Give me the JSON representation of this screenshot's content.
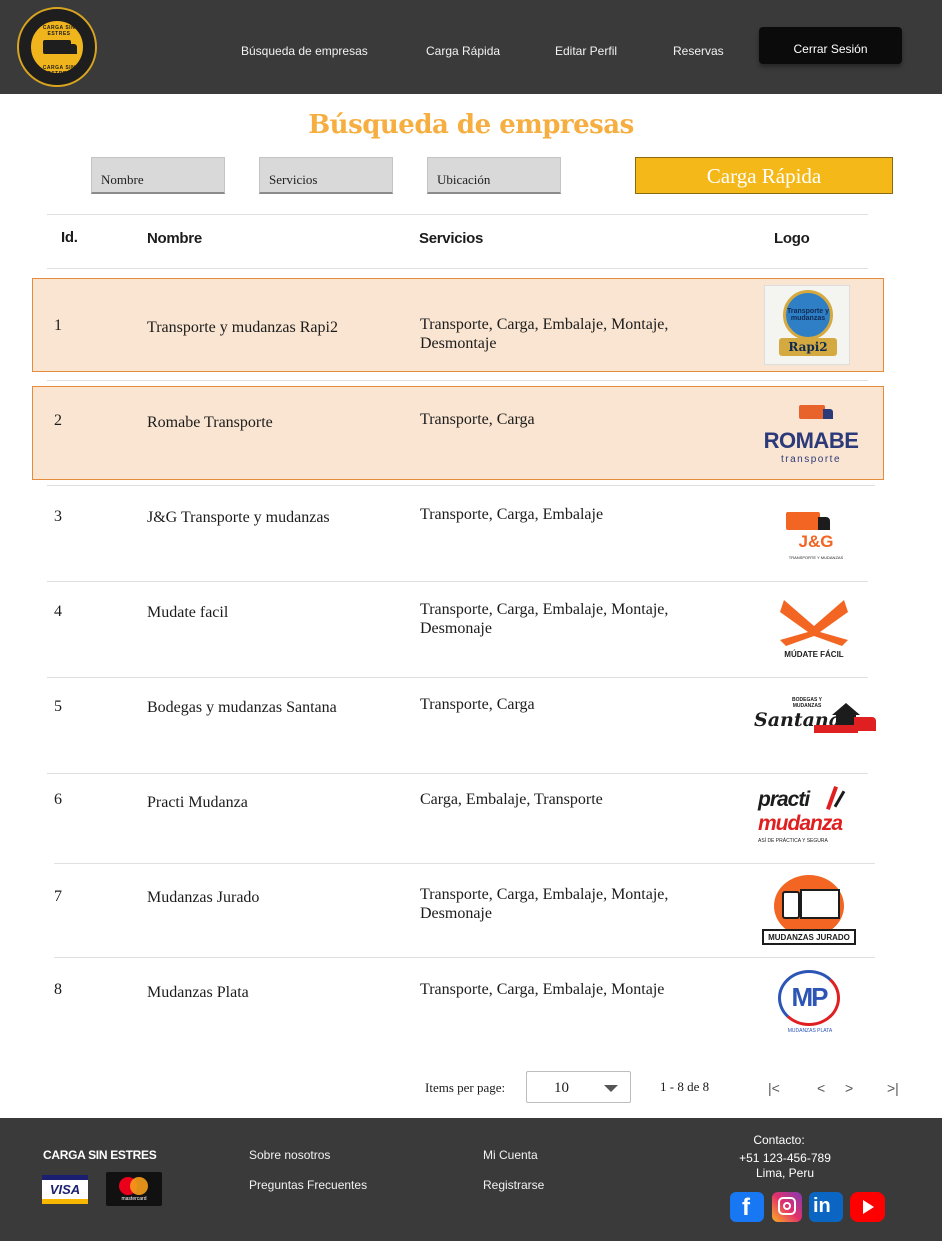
{
  "header": {
    "logo_text_top": "CARGA SIN ESTRES",
    "logo_text_bottom": "CARGA SIN ESTRES",
    "nav": {
      "busqueda": "Búsqueda de empresas",
      "carga_rapida": "Carga Rápida",
      "editar_perfil": "Editar Perfil",
      "reservas": "Reservas"
    },
    "logout_label": "Cerrar Sesión"
  },
  "main": {
    "title": "Búsqueda de empresas",
    "filters": {
      "nombre": "Nombre",
      "servicios": "Servicios",
      "ubicacion": "Ubicación"
    },
    "quick_button": "Carga Rápida",
    "table": {
      "columns": {
        "id": "Id.",
        "nombre": "Nombre",
        "servicios": "Servicios",
        "logo": "Logo"
      },
      "rows": [
        {
          "id": "1",
          "nombre": "Transporte y mudanzas Rapi2",
          "servicios": "Transporte, Carga, Embalaje, Montaje, Desmontaje",
          "logo_text": "Rapi2",
          "logo_sub": "Transporte y mudanzas"
        },
        {
          "id": "2",
          "nombre": "Romabe Transporte",
          "servicios": "Transporte, Carga",
          "logo_text": "ROMABE",
          "logo_sub": "transporte"
        },
        {
          "id": "3",
          "nombre": "J&G Transporte y mudanzas",
          "servicios": "Transporte, Carga, Embalaje",
          "logo_text": "J&G",
          "logo_sub": "TRANSPORTE Y MUDANZAS"
        },
        {
          "id": "4",
          "nombre": "Mudate facil",
          "servicios": "Transporte, Carga, Embalaje, Montaje, Desmonaje",
          "logo_text": "MÚDATE FÁCIL",
          "logo_sub": ""
        },
        {
          "id": "5",
          "nombre": "Bodegas y mudanzas Santana",
          "servicios": "Transporte, Carga",
          "logo_text": "Santana",
          "logo_sub": "BODEGAS Y MUDANZAS"
        },
        {
          "id": "6",
          "nombre": "Practi Mudanza",
          "servicios": "Carga, Embalaje, Transporte",
          "logo_text": "practi",
          "logo_text2": "mudanza",
          "logo_sub": "ASÍ DE PRÁCTICA Y SEGURA"
        },
        {
          "id": "7",
          "nombre": "Mudanzas Jurado",
          "servicios": "Transporte, Carga, Embalaje, Montaje, Desmonaje",
          "logo_text": "MUDANZAS JURADO",
          "logo_sub": ""
        },
        {
          "id": "8",
          "nombre": "Mudanzas Plata",
          "servicios": "Transporte, Carga, Embalaje, Montaje",
          "logo_text": "MP",
          "logo_sub": "MUDANZAS PLATA"
        }
      ]
    },
    "pagination": {
      "items_label": "Items per page:",
      "items_value": "10",
      "range": "1 - 8 de 8",
      "first": "|<",
      "prev": "<",
      "next": ">",
      "last": ">|"
    }
  },
  "footer": {
    "brand": "CARGA SIN ESTRES",
    "visa": "VISA",
    "mastercard": "mastercard",
    "links": {
      "about": "Sobre nosotros",
      "faq": "Preguntas Frecuentes",
      "account": "Mi Cuenta",
      "register": "Registrarse"
    },
    "contact": {
      "label": "Contacto:",
      "phone": "+51 123-456-789",
      "city": "Lima, Peru"
    }
  },
  "colors": {
    "header_bg": "#3a3a3a",
    "accent_title": "#f5ae3f",
    "accent_button": "#f5b819",
    "row_highlight": "#f9e5d1",
    "row_highlight_border": "#e58c3c"
  }
}
